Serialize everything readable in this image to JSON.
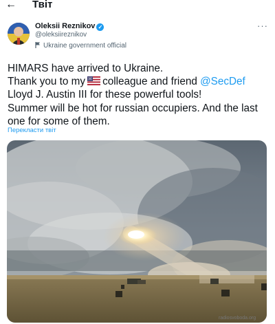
{
  "header": {
    "back_icon": "arrow-left-icon",
    "title": "Твіт"
  },
  "author": {
    "name": "Oleksii Reznikov",
    "verified_icon": "verified-badge-icon",
    "handle": "@oleksiireznikov",
    "label": "Ukraine government official",
    "label_icon": "flag-icon"
  },
  "more_icon": "more-options-icon",
  "tweet": {
    "line1": "HIMARS have arrived to Ukraine.",
    "line2_a": "Thank you to my",
    "line2_emoji": "us-flag-emoji",
    "line2_b": "colleague and friend",
    "line2_mention": "@SecDef",
    "line3": "Lloyd J. Austin III for these powerful tools!",
    "line4": "Summer will be hot for russian occupiers. And the last",
    "line5": "one for some of them."
  },
  "translate": "Перекласти твіт",
  "watermark": "radiosvoboda.org",
  "colors": {
    "accent": "#1d9bf0",
    "text": "#0f1419",
    "secondary": "#536471"
  }
}
